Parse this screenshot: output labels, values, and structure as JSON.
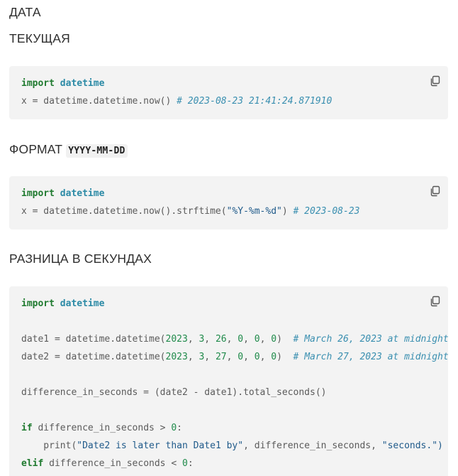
{
  "headings": {
    "data": "ДАТА",
    "current": "ТЕКУЩАЯ",
    "format": "ФОРМАТ",
    "format_code": "YYYY-MM-DD",
    "diff": "РАЗНИЦА В СЕКУНДАХ"
  },
  "block1": {
    "l1_kw": "import",
    "l1_mod": "datetime",
    "l2_code": "x = datetime.datetime.now() ",
    "l2_comment": "# 2023-08-23 21:41:24.871910"
  },
  "block2": {
    "l1_kw": "import",
    "l1_mod": "datetime",
    "l2_code_a": "x = datetime.datetime.now().strftime(",
    "l2_str": "\"%Y-%m-%d\"",
    "l2_code_b": ") ",
    "l2_comment": "# 2023-08-23"
  },
  "block3": {
    "l1_kw": "import",
    "l1_mod": "datetime",
    "l3_a": "date1 = datetime.datetime(",
    "l3_n1": "2023",
    "l3_n2": "3",
    "l3_n3": "26",
    "l3_n4": "0",
    "l3_n5": "0",
    "l3_n6": "0",
    "l3_comment": "# March 26, 2023 at midnight",
    "l4_a": "date2 = datetime.datetime(",
    "l4_n1": "2023",
    "l4_n2": "3",
    "l4_n3": "27",
    "l4_n4": "0",
    "l4_n5": "0",
    "l4_n6": "0",
    "l4_comment": "# March 27, 2023 at midnight",
    "l6": "difference_in_seconds = (date2 - date1).total_seconds()",
    "l8_kw": "if",
    "l8_a": " difference_in_seconds > ",
    "l8_num": "0",
    "l8_b": ":",
    "l9_a": "    print(",
    "l9_str1": "\"Date2 is later than Date1 by\"",
    "l9_b": ", difference_in_seconds, ",
    "l9_str2": "\"seconds.\")",
    "l10_kw": "elif",
    "l10_a": " difference_in_seconds < ",
    "l10_num": "0",
    "l10_b": ":"
  },
  "icons": {
    "copy": "copy-icon"
  },
  "colors": {
    "keyword": "#1f7a2f",
    "module": "#2b8aa6",
    "comment": "#3a8fb0",
    "number": "#1f8a4a",
    "block_bg": "#f3f3f3"
  }
}
